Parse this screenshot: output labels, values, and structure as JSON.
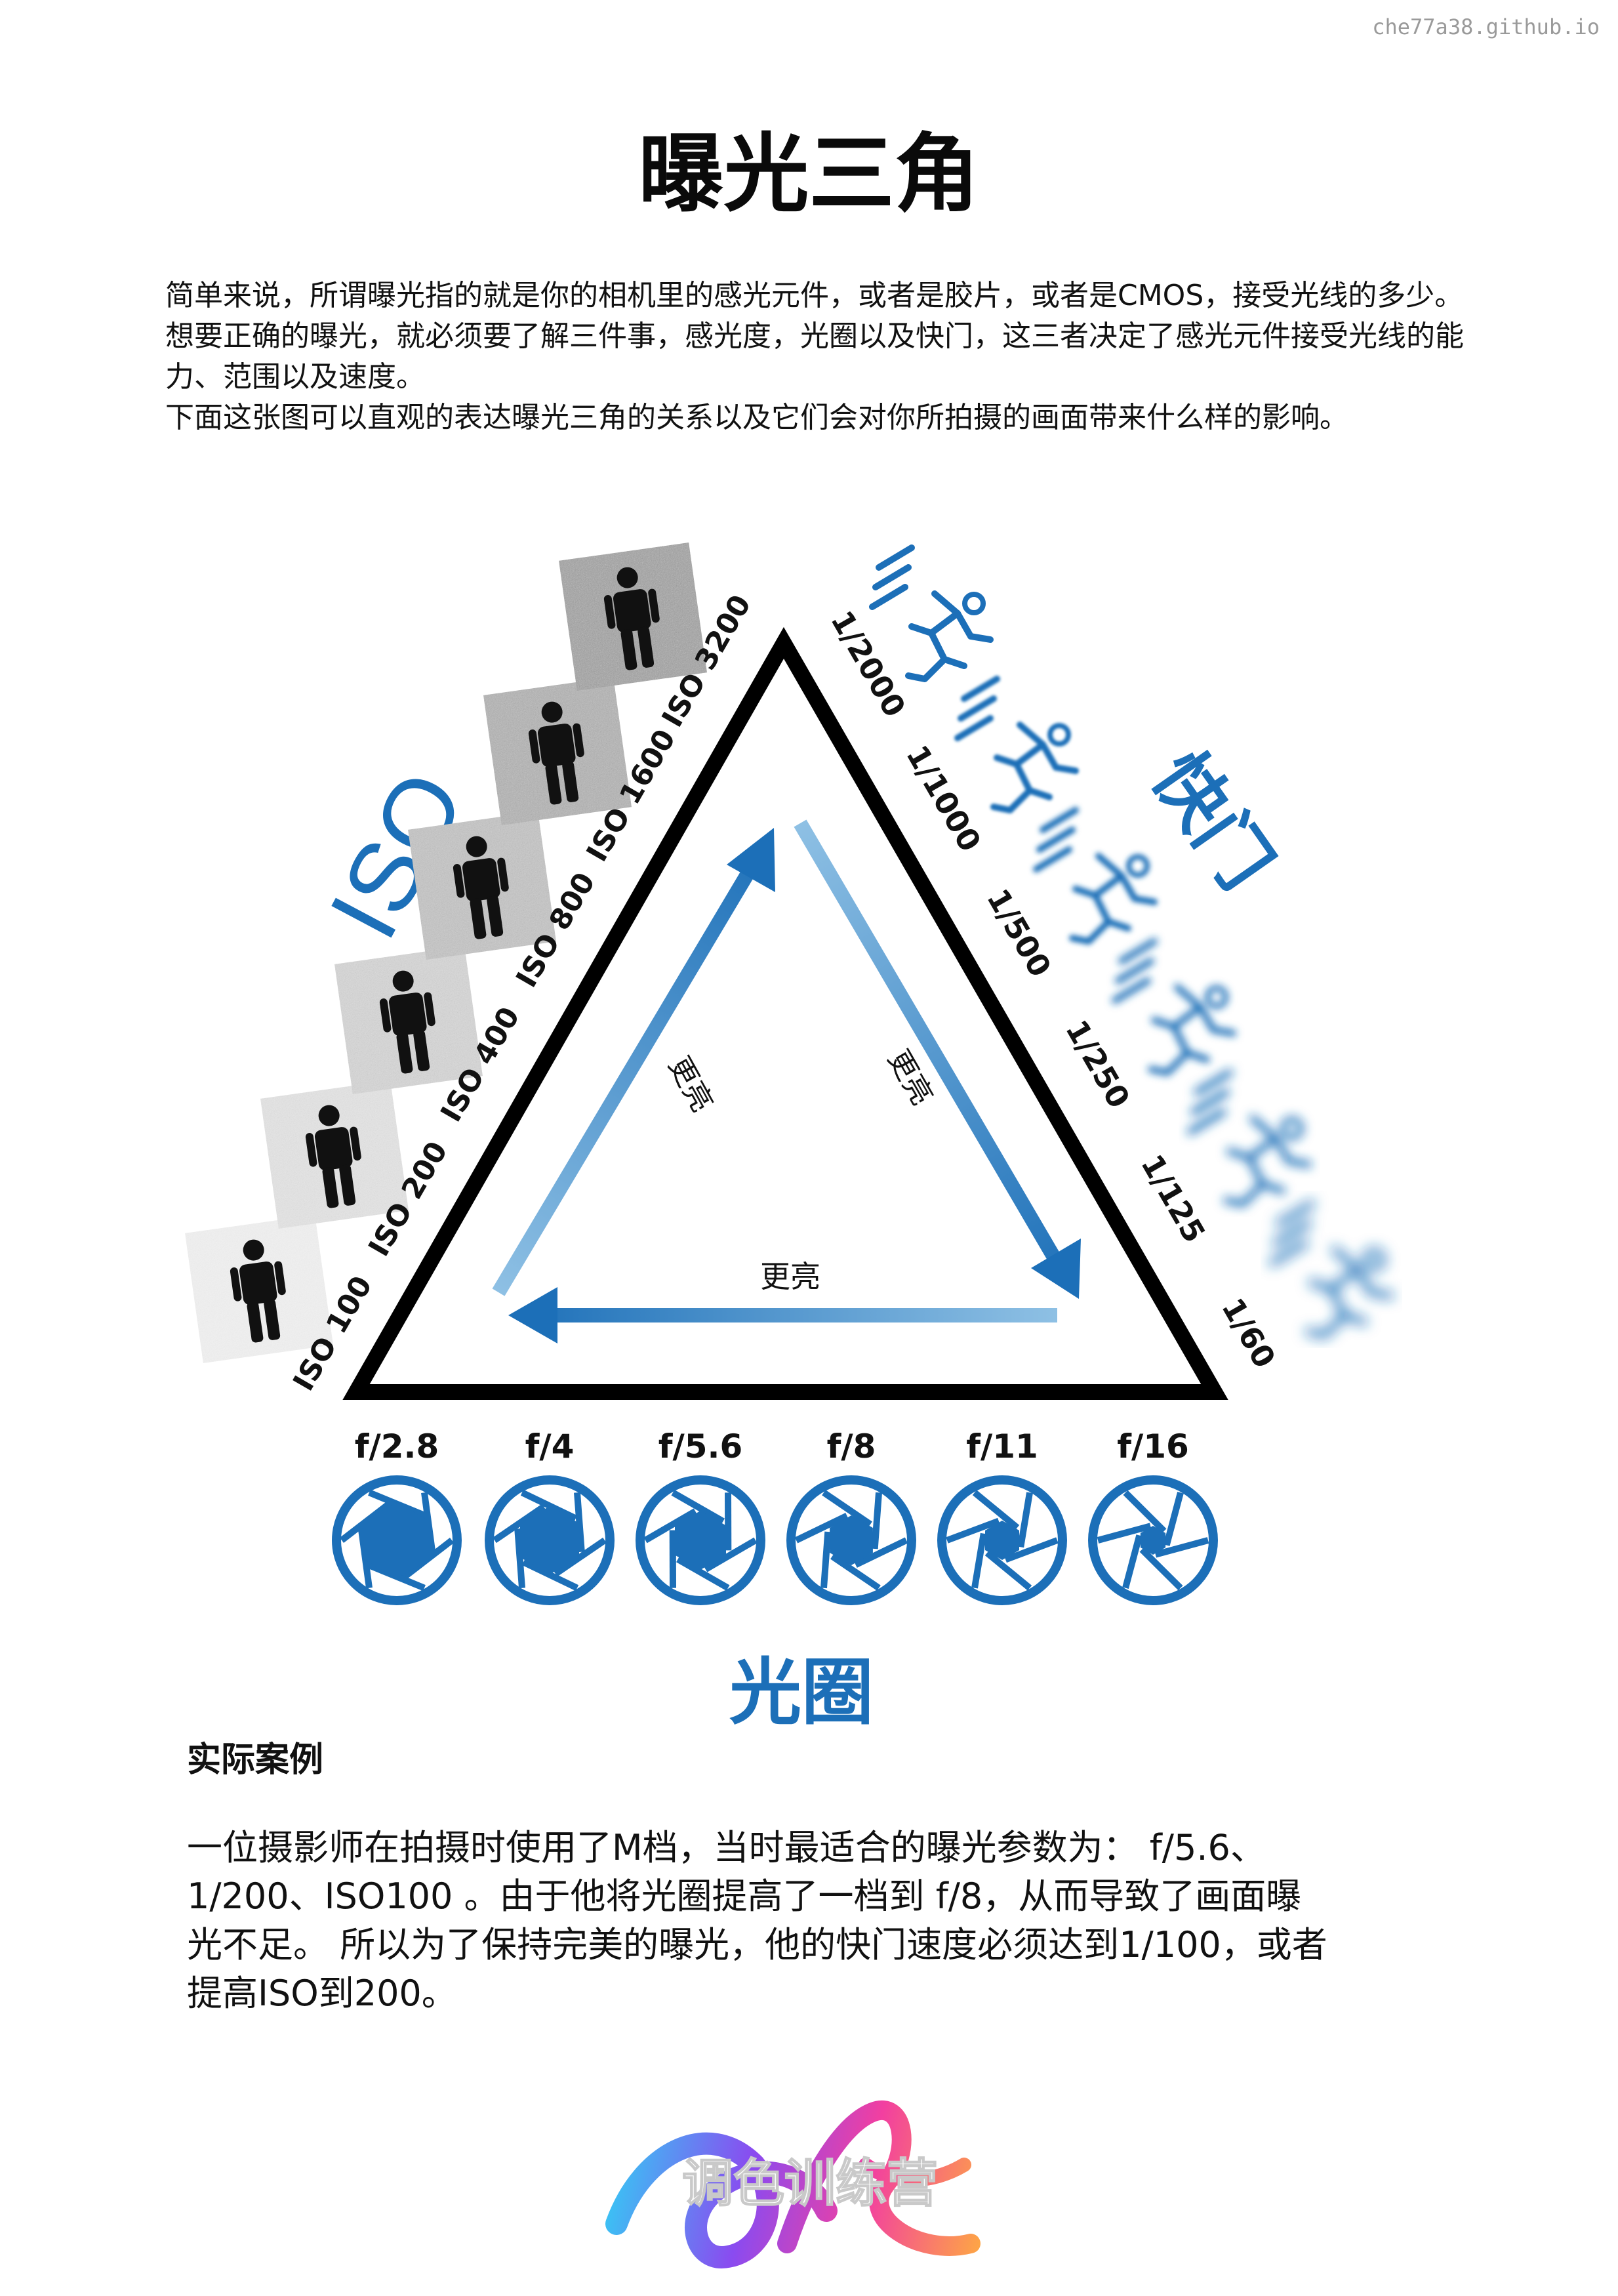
{
  "watermark": "che77a38.github.io",
  "title": "曝光三角",
  "intro": {
    "paragraph1": "简单来说，所谓曝光指的就是你的相机里的感光元件，或者是胶片，或者是CMOS，接受光线的多少。想要正确的曝光，就必须要了解三件事，感光度，光圈以及快门，这三者决定了感光元件接受光线的能力、范围以及速度。",
    "paragraph2": "下面这张图可以直观的表达曝光三角的关系以及它们会对你所拍摄的画面带来什么样的影响。"
  },
  "diagram": {
    "iso_title": "ISO",
    "shutter_title": "快门",
    "aperture_title": "光圈",
    "brighter_left": "更亮",
    "brighter_right": "更亮",
    "brighter_bottom": "更亮",
    "iso_values": [
      "ISO 100",
      "ISO 200",
      "ISO 400",
      "ISO 800",
      "ISO 1600",
      "ISO 3200"
    ],
    "shutter_values": [
      "1/2000",
      "1/1000",
      "1/500",
      "1/250",
      "1/125",
      "1/60"
    ],
    "aperture_values": [
      "f/2.8",
      "f/4",
      "f/5.6",
      "f/8",
      "f/11",
      "f/16"
    ],
    "colors": {
      "blue": "#1c6fb8",
      "light_blue": "#8ec0e4",
      "black": "#000000"
    },
    "icons": {
      "iso": "person-noise-icon",
      "shutter": "running-figure-icon",
      "aperture": "aperture-icon"
    }
  },
  "case": {
    "heading": "实际案例",
    "line1": "一位摄影师在拍摄时使用了M档，当时最适合的曝光参数为： f/5.6、",
    "line2": "1/200、ISO100 。由于他将光圈提高了一档到 f/8，从而导致了画面曝",
    "line3": "光不足。 所以为了保持完美的曝光，他的快门速度必须达到1/100，或者",
    "line4": "提高ISO到200。"
  },
  "logo_text": "调色训练营"
}
